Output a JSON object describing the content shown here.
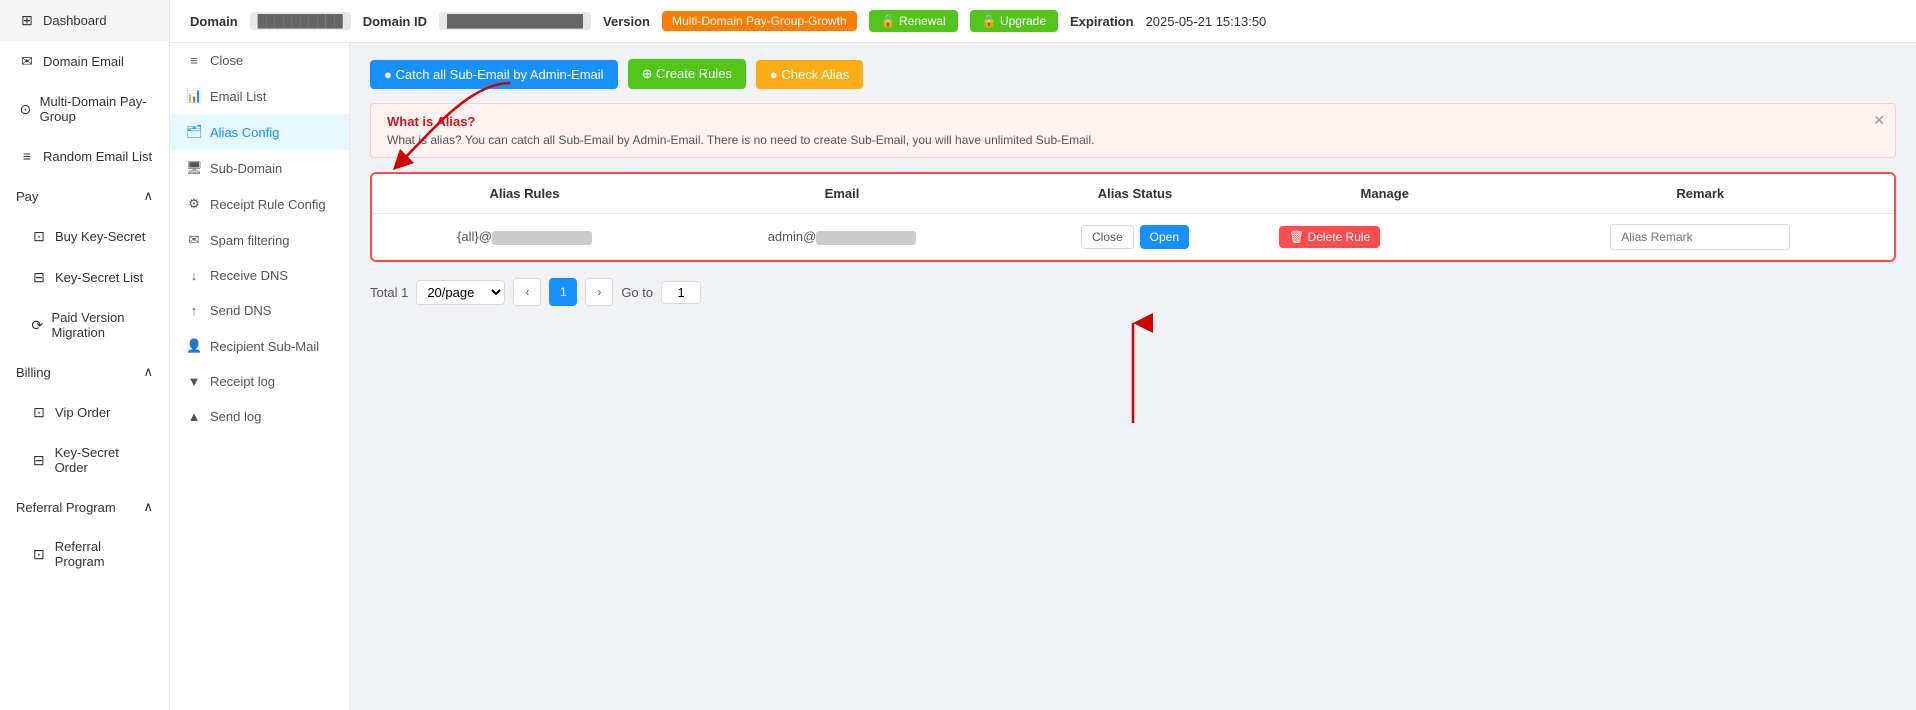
{
  "sidebar": {
    "items": [
      {
        "id": "dashboard",
        "label": "Dashboard",
        "icon": "⊞"
      },
      {
        "id": "domain-email",
        "label": "Domain Email",
        "icon": "✉"
      },
      {
        "id": "multi-domain",
        "label": "Multi-Domain Pay-Group",
        "icon": "⊙"
      },
      {
        "id": "random-email",
        "label": "Random Email List",
        "icon": "≡"
      },
      {
        "id": "pay",
        "label": "Pay",
        "icon": "💳",
        "hasChildren": true,
        "expanded": true
      },
      {
        "id": "buy-key",
        "label": "Buy Key-Secret",
        "icon": "⊡",
        "indent": true
      },
      {
        "id": "key-secret-list",
        "label": "Key-Secret List",
        "icon": "⊟",
        "indent": true
      },
      {
        "id": "paid-version",
        "label": "Paid Version Migration",
        "icon": "⟳",
        "indent": true
      },
      {
        "id": "billing",
        "label": "Billing",
        "icon": "📋",
        "hasChildren": true,
        "expanded": true
      },
      {
        "id": "vip-order",
        "label": "Vip Order",
        "icon": "⊡",
        "indent": true
      },
      {
        "id": "key-secret-order",
        "label": "Key-Secret Order",
        "icon": "⊟",
        "indent": true
      },
      {
        "id": "referral-program",
        "label": "Referral Program",
        "icon": "👥",
        "hasChildren": true,
        "expanded": true
      },
      {
        "id": "referral-program-item",
        "label": "Referral Program",
        "icon": "⊡",
        "indent": true
      }
    ]
  },
  "header": {
    "domain_label": "Domain",
    "domain_value": "██████████",
    "domain_id_label": "Domain ID",
    "domain_id_value": "████████████████",
    "version_label": "Version",
    "version_value": "Multi-Domain Pay-Group-Growth",
    "renewal_label": "🔒 Renewal",
    "upgrade_label": "🔒 Upgrade",
    "expiration_label": "Expiration",
    "expiration_value": "2025-05-21 15:13:50"
  },
  "sub_nav": {
    "items": [
      {
        "id": "close",
        "label": "Close",
        "icon": "≡"
      },
      {
        "id": "email-list",
        "label": "Email List",
        "icon": "📊"
      },
      {
        "id": "alias-config",
        "label": "Alias Config",
        "icon": "🗂",
        "active": true
      },
      {
        "id": "sub-domain",
        "label": "Sub-Domain",
        "icon": "🖥"
      },
      {
        "id": "receipt-rule",
        "label": "Receipt Rule Config",
        "icon": "⚙"
      },
      {
        "id": "spam-filtering",
        "label": "Spam filtering",
        "icon": "✉"
      },
      {
        "id": "receive-dns",
        "label": "Receive DNS",
        "icon": "↓"
      },
      {
        "id": "send-dns",
        "label": "Send DNS",
        "icon": "↑"
      },
      {
        "id": "recipient-sub",
        "label": "Recipient Sub-Mail",
        "icon": "👤"
      },
      {
        "id": "receipt-log",
        "label": "Receipt log",
        "icon": "▼"
      },
      {
        "id": "send-log",
        "label": "Send log",
        "icon": "▲"
      }
    ]
  },
  "toolbar": {
    "catch_all_label": "● Catch all Sub-Email by Admin-Email",
    "create_rules_label": "⊕ Create Rules",
    "check_alias_label": "● Check Alias"
  },
  "info_box": {
    "title": "What is Alias?",
    "text": "What is alias? You can catch all Sub-Email by Admin-Email. There is no need to create Sub-Email, you will have unlimited Sub-Email."
  },
  "table": {
    "columns": [
      "Alias Rules",
      "Email",
      "Alias Status",
      "Manage",
      "Remark"
    ],
    "rows": [
      {
        "alias_rules": "{all}@██████████",
        "email": "admin@█████████",
        "alias_status_close": "Close",
        "alias_status_open": "Open",
        "remark_placeholder": "Alias Remark"
      }
    ]
  },
  "pagination": {
    "total_label": "Total 1",
    "per_page": "20/page",
    "current_page": "1",
    "goto_label": "Go to",
    "goto_value": "1"
  }
}
